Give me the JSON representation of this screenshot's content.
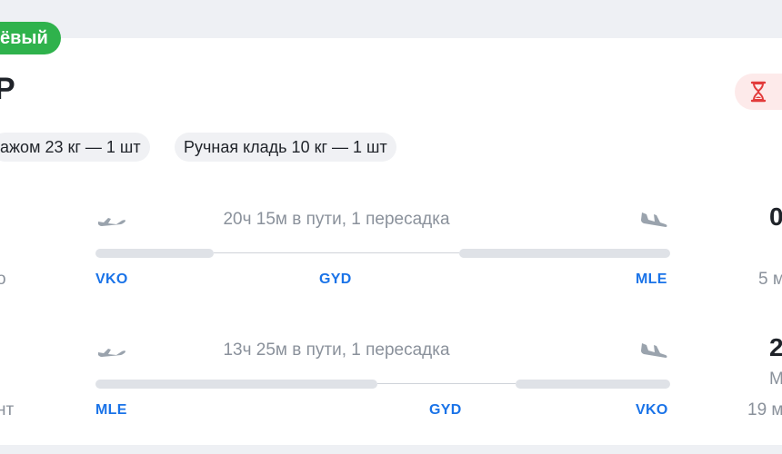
{
  "badge": {
    "label": "ёвый"
  },
  "price": {
    "text": "Р"
  },
  "timer": {
    "icon": "hourglass-icon",
    "color": "#e23b3b"
  },
  "baggage": {
    "checked": "ажом 23 кг — 1 шт",
    "hand": "Ручная кладь 10 кг — 1 шт"
  },
  "outbound": {
    "duration": "20ч 15м в пути, 1 пересадка",
    "airports": {
      "from": "VKO",
      "via": "GYD",
      "to": "MLE"
    },
    "left_fragment": "о",
    "right_top": "0",
    "right_sub": "5 м"
  },
  "return": {
    "duration": "13ч 25м в пути, 1 пересадка",
    "airports": {
      "from": "MLE",
      "via": "GYD",
      "to": "VKO"
    },
    "left_fragment": "нт",
    "right_top": "2",
    "right_mid": "М",
    "right_sub": "19 м"
  },
  "colors": {
    "accent": "#1a73e8",
    "badge": "#2fb24c",
    "timer_bg": "#fdeaea"
  }
}
